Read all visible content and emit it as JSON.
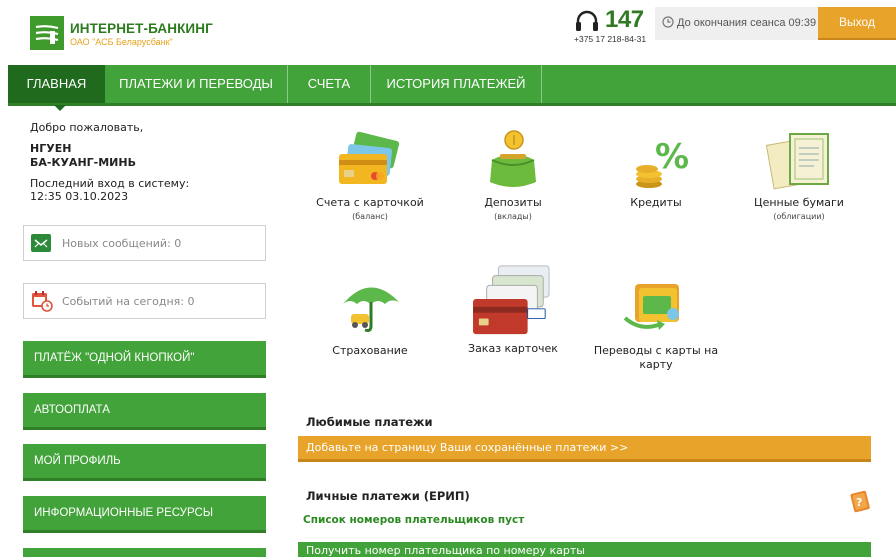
{
  "header": {
    "brand_title": "ИНТЕРНЕТ-БАНКИНГ",
    "brand_subtitle": "ОАО \"АСБ Беларусбанк\"",
    "hotline_number": "147",
    "hotline_phone": "+375 17 218-84-31",
    "session_text": "До окончания сеанса 09:39",
    "logout_label": "Выход"
  },
  "nav": {
    "items": [
      {
        "label": "ГЛАВНАЯ",
        "active": true
      },
      {
        "label": "ПЛАТЕЖИ И ПЕРЕВОДЫ"
      },
      {
        "label": "СЧЕТА"
      },
      {
        "label": "ИСТОРИЯ ПЛАТЕЖЕЙ"
      }
    ]
  },
  "sidebar": {
    "welcome": "Добро пожаловать,",
    "user_line1": "НГУЕН",
    "user_line2": "БА-КУАНГ-МИНЬ",
    "last_login_label": "Последний вход в систему:",
    "last_login_time": "12:35 03.10.2023",
    "messages_label": "Новых сообщений: 0",
    "events_label": "Событий на сегодня: 0",
    "buttons": [
      "ПЛАТЁЖ \"ОДНОЙ КНОПКОЙ\"",
      "АВТООПЛАТА",
      "МОЙ ПРОФИЛЬ",
      "ИНФОРМАЦИОННЫЕ РЕСУРСЫ"
    ]
  },
  "services": [
    {
      "title": "Счета с карточкой",
      "sub": "(баланс)",
      "icon": "cards-icon"
    },
    {
      "title": "Депозиты",
      "sub": "(вклады)",
      "icon": "wallet-icon"
    },
    {
      "title": "Кредиты",
      "sub": "",
      "icon": "percent-coins-icon"
    },
    {
      "title": "Ценные бумаги",
      "sub": "(облигации)",
      "icon": "certificates-icon"
    },
    {
      "title": "Страхование",
      "sub": "",
      "icon": "umbrella-car-icon"
    },
    {
      "title": "Заказ карточек",
      "sub": "",
      "icon": "card-stack-icon"
    },
    {
      "title": "Переводы с карты на карту",
      "sub": "",
      "icon": "card-transfer-icon"
    }
  ],
  "payments": {
    "favorites_title": "Любимые платежи",
    "favorites_bar": "Добавьте на страницу Ваши сохранённые платежи >>",
    "personal_title": "Личные платежи (ЕРИП)",
    "empty_list": "Список номеров плательщиков пуст",
    "get_number_bar": "Получить номер плательщика по номеру карты"
  },
  "colors": {
    "brand_green": "#42a33a",
    "dark_green": "#1f6a1d",
    "accent_orange": "#e8a32a"
  }
}
